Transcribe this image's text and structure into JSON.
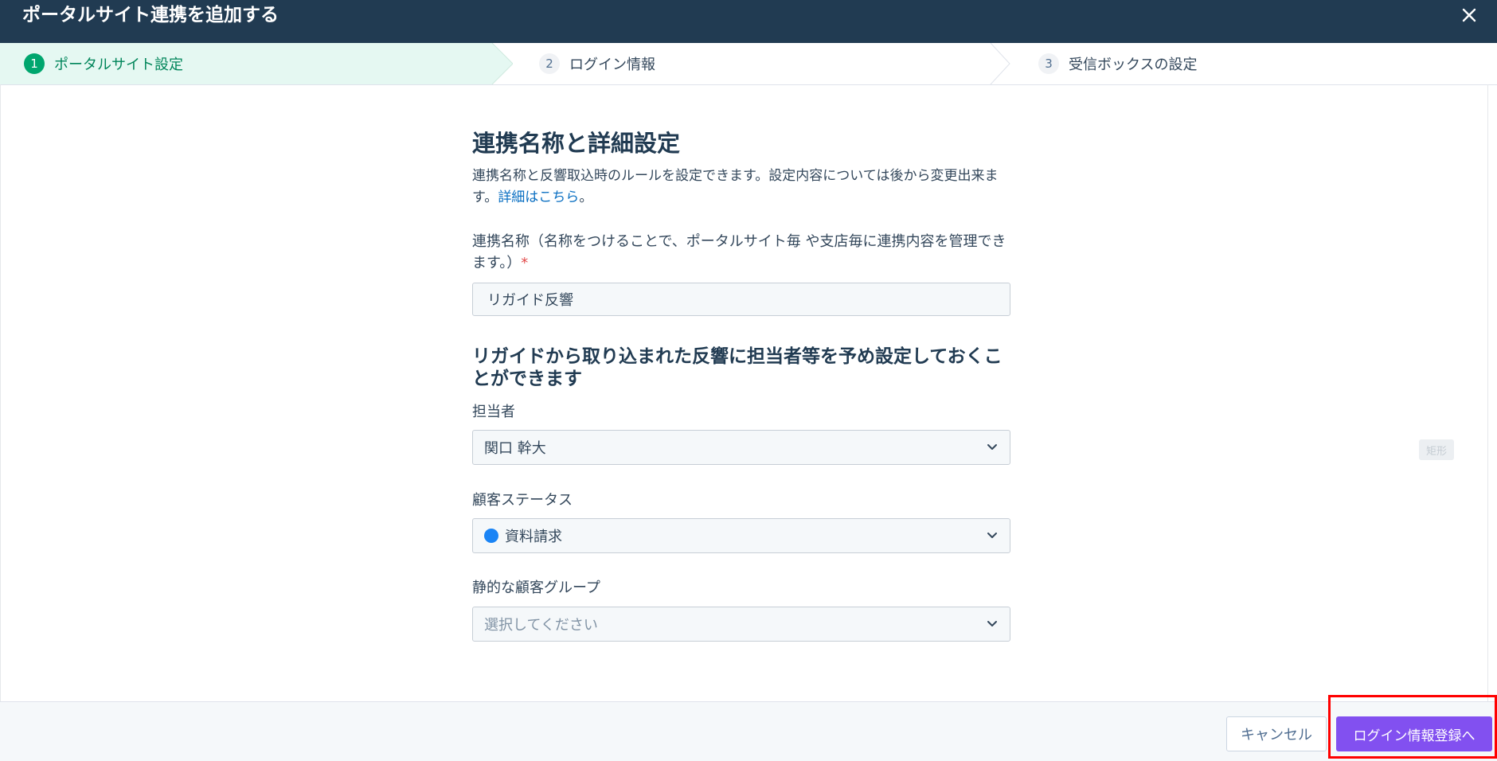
{
  "modal": {
    "title": "ポータルサイト連携を追加する"
  },
  "stepper": {
    "steps": [
      {
        "number": "1",
        "label": "ポータルサイト設定",
        "state": "active"
      },
      {
        "number": "2",
        "label": "ログイン情報",
        "state": "inactive"
      },
      {
        "number": "3",
        "label": "受信ボックスの設定",
        "state": "inactive"
      }
    ]
  },
  "form": {
    "section_title": "連携名称と詳細設定",
    "description": "連携名称と反響取込時のルールを設定できます。設定内容については後から変更出来ます。",
    "description_link": "詳細はこちら",
    "description_end": "。",
    "name_label": "連携名称（名称をつけることで、ポータルサイト毎 や支店毎に連携内容を管理できます。）",
    "name_required_mark": "*",
    "name_value": "リガイド反響",
    "defaults_title": "リガイドから取り込まれた反響に担当者等を予め設定しておくことができます",
    "owner_label": "担当者",
    "owner_value": "関口 幹大",
    "status_label": "顧客ステータス",
    "status_value": "資料請求",
    "status_color": "#1a84f5",
    "group_label": "静的な顧客グループ",
    "group_placeholder": "選択してください"
  },
  "ghost_tag": "矩形",
  "footer": {
    "cancel_label": "キャンセル",
    "next_label": "ログイン情報登録へ"
  },
  "colors": {
    "header_bg": "#213b52",
    "step_active_bg": "#e5f8f2",
    "step_active": "#00a66e",
    "primary_button": "#8250f0",
    "highlight": "#ff0000"
  }
}
